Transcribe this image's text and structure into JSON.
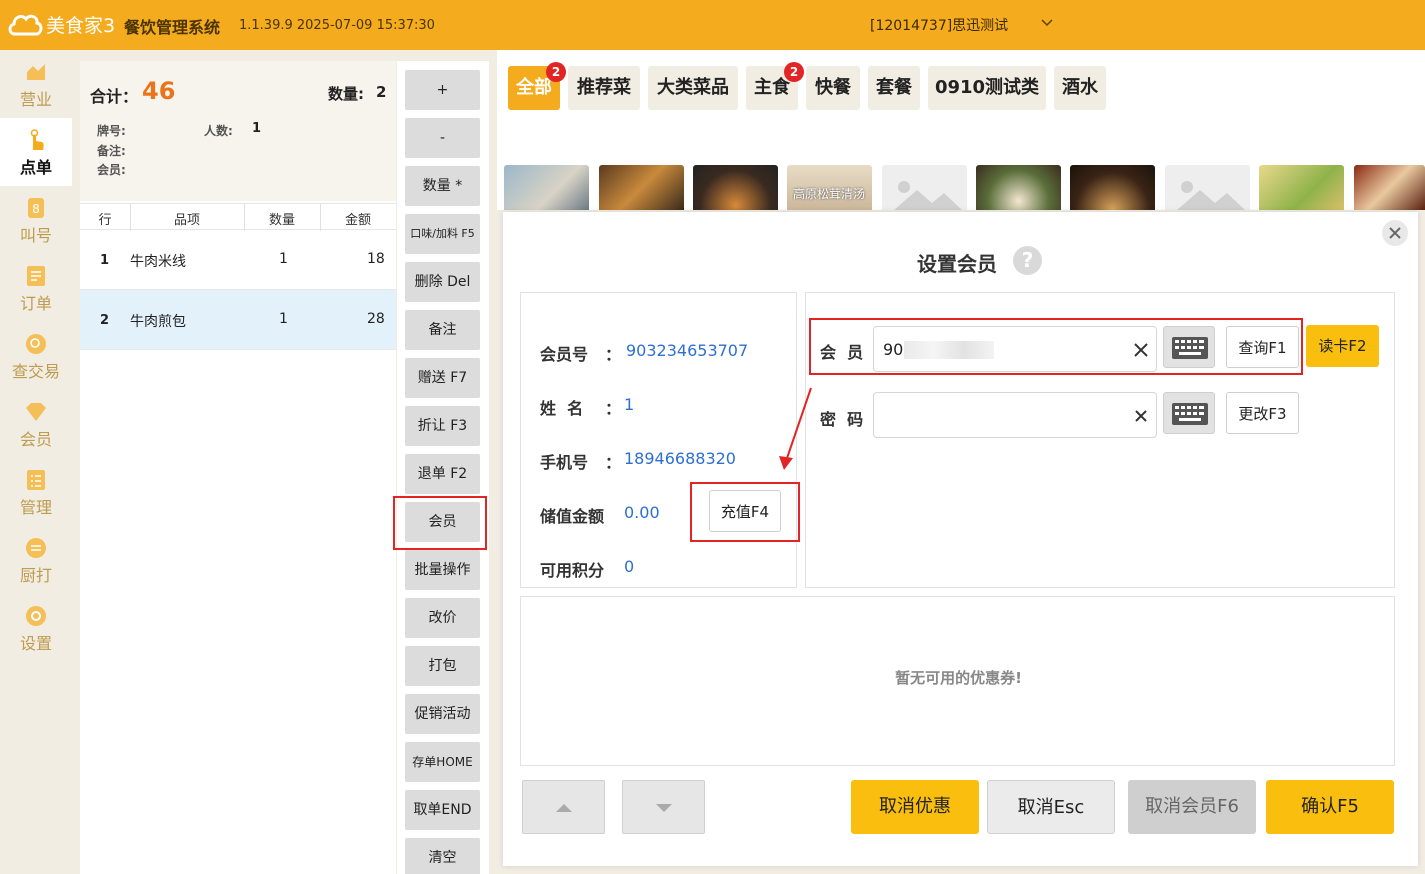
{
  "topbar": {
    "logo_text": "美食家3",
    "system_name": "餐饮管理系统",
    "version": "1.1.39.9 2025-07-09 15:37:30",
    "store": "[12014737]思迅测试",
    "bg_color": "#f5ab1e"
  },
  "sidenav": {
    "items": [
      {
        "label": "营业",
        "icon": "chart-icon"
      },
      {
        "label": "点单",
        "icon": "tap-hand-icon",
        "active": true
      },
      {
        "label": "叫号",
        "icon": "number-icon"
      },
      {
        "label": "订单",
        "icon": "list-icon"
      },
      {
        "label": "查交易",
        "icon": "search-icon"
      },
      {
        "label": "会员",
        "icon": "diamond-icon"
      },
      {
        "label": "管理",
        "icon": "checklist-icon"
      },
      {
        "label": "厨打",
        "icon": "printer-icon"
      },
      {
        "label": "设置",
        "icon": "gear-icon"
      }
    ]
  },
  "order": {
    "total_label": "合计：",
    "total_value": "46",
    "qty_label": "数量:",
    "qty_value": "2",
    "plate_label": "牌号:",
    "people_label": "人数:",
    "people_value": "1",
    "note_label": "备注:",
    "member_label": "会员:",
    "columns": [
      "行",
      "品项",
      "数量",
      "金额"
    ],
    "rows": [
      {
        "line": "1",
        "item": "牛肉米线",
        "qty": "1",
        "amount": "18"
      },
      {
        "line": "2",
        "item": "牛肉煎包",
        "qty": "1",
        "amount": "28"
      }
    ]
  },
  "actions": [
    "+",
    "-",
    "数量 *",
    "口味/加料 F5",
    "删除 Del",
    "备注",
    "赠送 F7",
    "折让 F3",
    "退单 F2",
    "会员",
    "批量操作",
    "改价",
    "打包",
    "促销活动",
    "存单HOME",
    "取单END",
    "清空"
  ],
  "categories": [
    {
      "label": "全部",
      "badge": "2",
      "active": true
    },
    {
      "label": "推荐菜"
    },
    {
      "label": "大类菜品"
    },
    {
      "label": "主食",
      "badge": "2"
    },
    {
      "label": "快餐"
    },
    {
      "label": "套餐"
    },
    {
      "label": "0910测试类"
    },
    {
      "label": "酒水"
    }
  ],
  "thumb_caption": "高原松茸清汤",
  "modal": {
    "title": "设置会员",
    "help": "?",
    "member_no_label": "会员号",
    "member_no": "903234653707",
    "name_label": "姓  名",
    "name": "1",
    "phone_label": "手机号",
    "phone": "18946688320",
    "balance_label": "储值金额",
    "balance": "0.00",
    "points_label": "可用积分",
    "points": "0",
    "colon": "：",
    "recharge_btn": "充值F4",
    "member_field_label": "会  员",
    "member_field_value": "90",
    "query_btn": "查询F1",
    "read_card_btn": "读卡F2",
    "password_label": "密  码",
    "password_value": "",
    "change_btn": "更改F3",
    "no_coupon": "暂无可用的优惠券!",
    "cancel_discount": "取消优惠",
    "cancel_esc": "取消Esc",
    "cancel_member": "取消会员F6",
    "confirm": "确认F5"
  },
  "accent_red": "#e32424",
  "accent_yellow": "#f9be0e"
}
